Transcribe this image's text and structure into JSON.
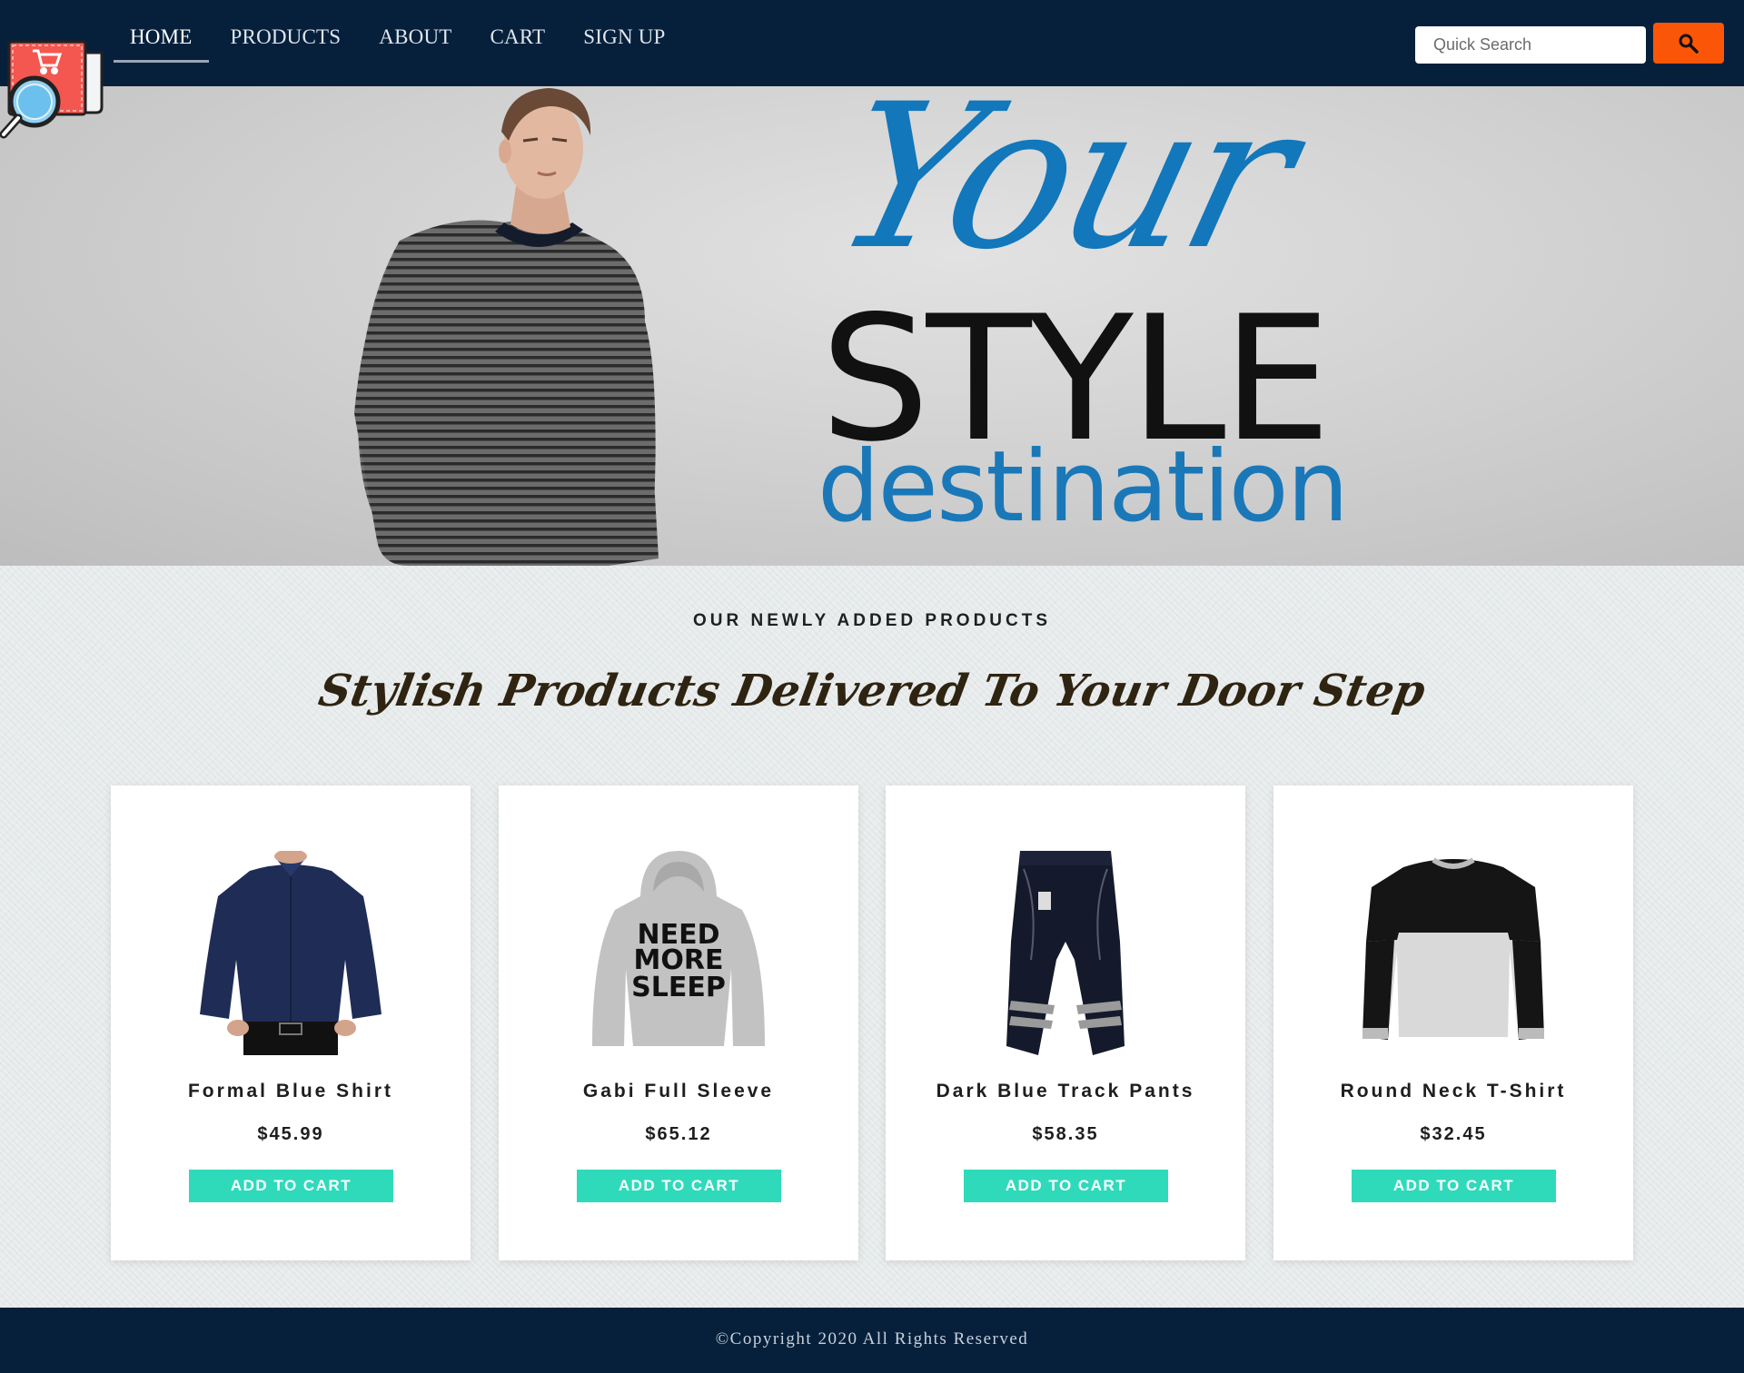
{
  "colors": {
    "navbar_bg": "#06203c",
    "search_button": "#fb5608",
    "add_to_cart_button": "#2fdabb",
    "hero_blue": "#1277bb",
    "footer_bg": "#06203c"
  },
  "logo": {
    "icon": "shopping-cart-magnifier-icon"
  },
  "nav": {
    "items": [
      {
        "label": "HOME",
        "active": true
      },
      {
        "label": "PRODUCTS",
        "active": false
      },
      {
        "label": "ABOUT",
        "active": false
      },
      {
        "label": "CART",
        "active": false
      },
      {
        "label": "SIGN UP",
        "active": false
      }
    ]
  },
  "search": {
    "placeholder": "Quick Search",
    "value": "",
    "button_icon": "search-icon"
  },
  "hero": {
    "line1": "Your",
    "line2": "STYLE",
    "line3": "destination",
    "image": "man-in-striped-sweater"
  },
  "section": {
    "eyebrow": "OUR NEWLY ADDED PRODUCTS",
    "tagline": "Stylish Products Delivered To Your Door Step"
  },
  "products": [
    {
      "name": "Formal Blue Shirt",
      "price": "$45.99",
      "button": "ADD TO CART",
      "image": "formal-blue-shirt"
    },
    {
      "name": "Gabi Full Sleeve",
      "price": "$65.12",
      "button": "ADD TO CART",
      "image": "grey-hoodie",
      "print_lines": [
        "NEED",
        "MORE",
        "SLEEP"
      ]
    },
    {
      "name": "Dark Blue Track Pants",
      "price": "$58.35",
      "button": "ADD TO CART",
      "image": "dark-track-pants"
    },
    {
      "name": "Round Neck T-Shirt",
      "price": "$32.45",
      "button": "ADD TO CART",
      "image": "round-neck-tshirt"
    }
  ],
  "footer": {
    "text": "©Copyright 2020 All Rights Reserved"
  }
}
